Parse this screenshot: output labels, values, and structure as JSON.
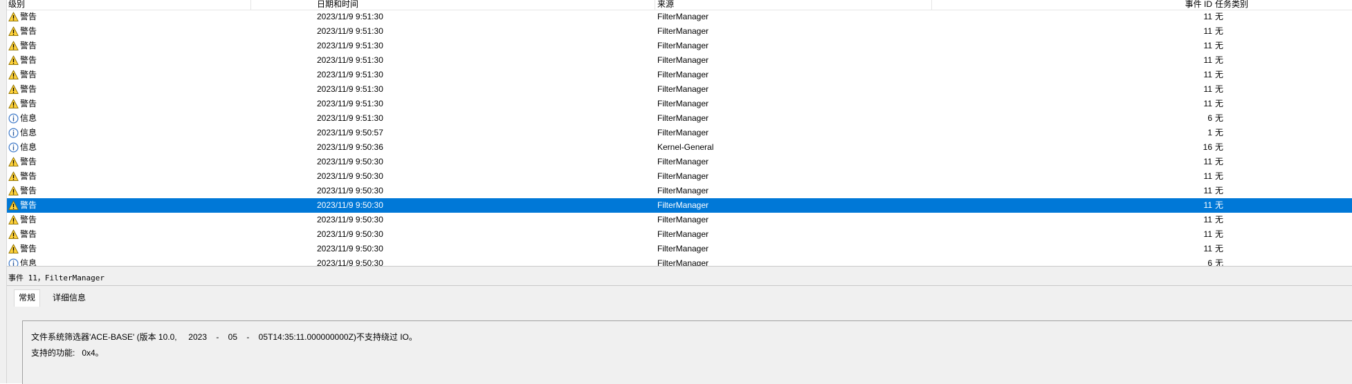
{
  "columns": {
    "level": "级别",
    "date": "日期和时间",
    "source": "来源",
    "event_id": "事件 ID",
    "task": "任务类别"
  },
  "icon_names": {
    "warning": "warning-triangle-icon",
    "info": "info-circle-icon"
  },
  "colors": {
    "selection": "#0078d7",
    "warning_fill": "#ffd23a",
    "info_stroke": "#3c78c8"
  },
  "rows": [
    {
      "type": "warning",
      "level": "警告",
      "date": "2023/11/9 9:51:30",
      "source": "FilterManager",
      "event_id": "11",
      "task": "无"
    },
    {
      "type": "warning",
      "level": "警告",
      "date": "2023/11/9 9:51:30",
      "source": "FilterManager",
      "event_id": "11",
      "task": "无"
    },
    {
      "type": "warning",
      "level": "警告",
      "date": "2023/11/9 9:51:30",
      "source": "FilterManager",
      "event_id": "11",
      "task": "无"
    },
    {
      "type": "warning",
      "level": "警告",
      "date": "2023/11/9 9:51:30",
      "source": "FilterManager",
      "event_id": "11",
      "task": "无"
    },
    {
      "type": "warning",
      "level": "警告",
      "date": "2023/11/9 9:51:30",
      "source": "FilterManager",
      "event_id": "11",
      "task": "无"
    },
    {
      "type": "warning",
      "level": "警告",
      "date": "2023/11/9 9:51:30",
      "source": "FilterManager",
      "event_id": "11",
      "task": "无"
    },
    {
      "type": "warning",
      "level": "警告",
      "date": "2023/11/9 9:51:30",
      "source": "FilterManager",
      "event_id": "11",
      "task": "无"
    },
    {
      "type": "info",
      "level": "信息",
      "date": "2023/11/9 9:51:30",
      "source": "FilterManager",
      "event_id": "6",
      "task": "无"
    },
    {
      "type": "info",
      "level": "信息",
      "date": "2023/11/9 9:50:57",
      "source": "FilterManager",
      "event_id": "1",
      "task": "无"
    },
    {
      "type": "info",
      "level": "信息",
      "date": "2023/11/9 9:50:36",
      "source": "Kernel-General",
      "event_id": "16",
      "task": "无"
    },
    {
      "type": "warning",
      "level": "警告",
      "date": "2023/11/9 9:50:30",
      "source": "FilterManager",
      "event_id": "11",
      "task": "无"
    },
    {
      "type": "warning",
      "level": "警告",
      "date": "2023/11/9 9:50:30",
      "source": "FilterManager",
      "event_id": "11",
      "task": "无"
    },
    {
      "type": "warning",
      "level": "警告",
      "date": "2023/11/9 9:50:30",
      "source": "FilterManager",
      "event_id": "11",
      "task": "无"
    },
    {
      "type": "warning",
      "level": "警告",
      "date": "2023/11/9 9:50:30",
      "source": "FilterManager",
      "event_id": "11",
      "task": "无",
      "selected": true
    },
    {
      "type": "warning",
      "level": "警告",
      "date": "2023/11/9 9:50:30",
      "source": "FilterManager",
      "event_id": "11",
      "task": "无"
    },
    {
      "type": "warning",
      "level": "警告",
      "date": "2023/11/9 9:50:30",
      "source": "FilterManager",
      "event_id": "11",
      "task": "无"
    },
    {
      "type": "warning",
      "level": "警告",
      "date": "2023/11/9 9:50:30",
      "source": "FilterManager",
      "event_id": "11",
      "task": "无"
    },
    {
      "type": "info",
      "level": "信息",
      "date": "2023/11/9 9:50:30",
      "source": "FilterManager",
      "event_id": "6",
      "task": "无"
    }
  ],
  "detail": {
    "title": "事件 11，FilterManager",
    "tabs": [
      "常规",
      "详细信息"
    ],
    "active_tab": 0,
    "message_line1": "文件系统筛选器'ACE-BASE' (版本 10.0,     2023    -    05    -    05T14:35:11.000000000Z)不支持绕过 IO。",
    "message_line2": "支持的功能:   0x4。"
  }
}
